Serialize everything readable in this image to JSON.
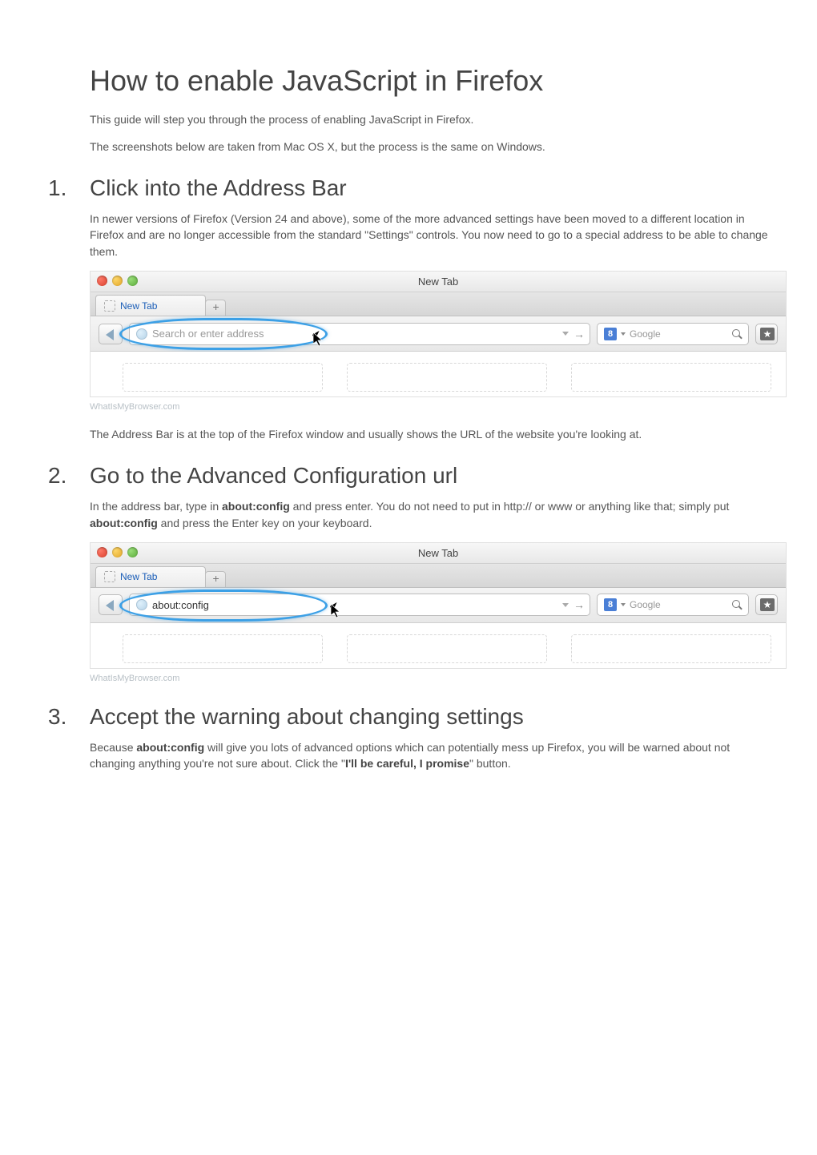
{
  "page": {
    "title": "How to enable JavaScript in Firefox",
    "intro1": "This guide will step you through the process of enabling JavaScript in Firefox.",
    "intro2": "The screenshots below are taken from Mac OS X, but the process is the same on Windows."
  },
  "steps": [
    {
      "num": "1.",
      "heading": "Click into the Address Bar",
      "para_before": "In newer versions of Firefox (Version 24 and above), some of the more advanced settings have been moved to a different location in Firefox and are no longer accessible from the standard \"Settings\" controls. You now need to go to a special address to be able to change them.",
      "para_after": "The Address Bar is at the top of the Firefox window and usually shows the URL of the website you're looking at."
    },
    {
      "num": "2.",
      "heading": "Go to the Advanced Configuration url",
      "para_before_html": "In the address bar, type in <strong>about:config</strong> and press enter. You do not need to put in http:// or www or anything like that; simply put <strong>about:config</strong> and press the Enter key on your keyboard."
    },
    {
      "num": "3.",
      "heading": "Accept the warning about changing settings",
      "para_before_html": "Because <strong>about:config</strong> will give you lots of advanced options which can potentially mess up Firefox, you will be warned about not changing anything you're not sure about. Click the \"<strong>I'll be careful, I promise</strong>\" button."
    }
  ],
  "screenshot": {
    "window_title": "New Tab",
    "tab_label": "New Tab",
    "address_placeholder": "Search or enter address",
    "address_typed": "about:config",
    "search_engine": "Google",
    "search_badge": "8",
    "watermark": "WhatIsMyBrowser.com"
  }
}
